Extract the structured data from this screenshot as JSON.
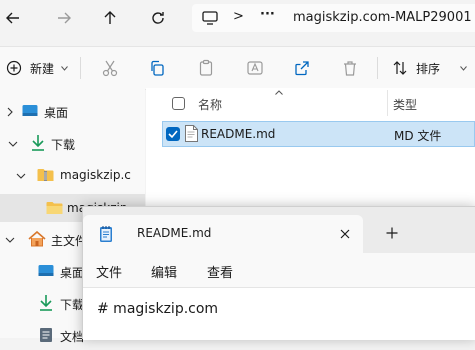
{
  "address": {
    "path": "magiskzip.com-MALP29001",
    "more": "···",
    "sep": ">"
  },
  "commands": {
    "new_label": "新建",
    "sort_label": "排序"
  },
  "tree": [
    {
      "label": "桌面"
    },
    {
      "label": "下载"
    },
    {
      "label": "magiskzip.c"
    },
    {
      "label": "magiskzip"
    },
    {
      "label": "主文件夹"
    },
    {
      "label": "桌面"
    },
    {
      "label": "下载"
    },
    {
      "label": "文档"
    }
  ],
  "columns": {
    "name": "名称",
    "type": "类型"
  },
  "files": [
    {
      "name": "README.md",
      "type": "MD 文件"
    }
  ],
  "notepad": {
    "tab_title": "README.md",
    "menus": [
      "文件",
      "编辑",
      "查看"
    ],
    "content": "# magiskzip.com"
  },
  "colors": {
    "accent": "#0067c0",
    "selection": "#cce4f7",
    "folder": "#f4c04c"
  }
}
